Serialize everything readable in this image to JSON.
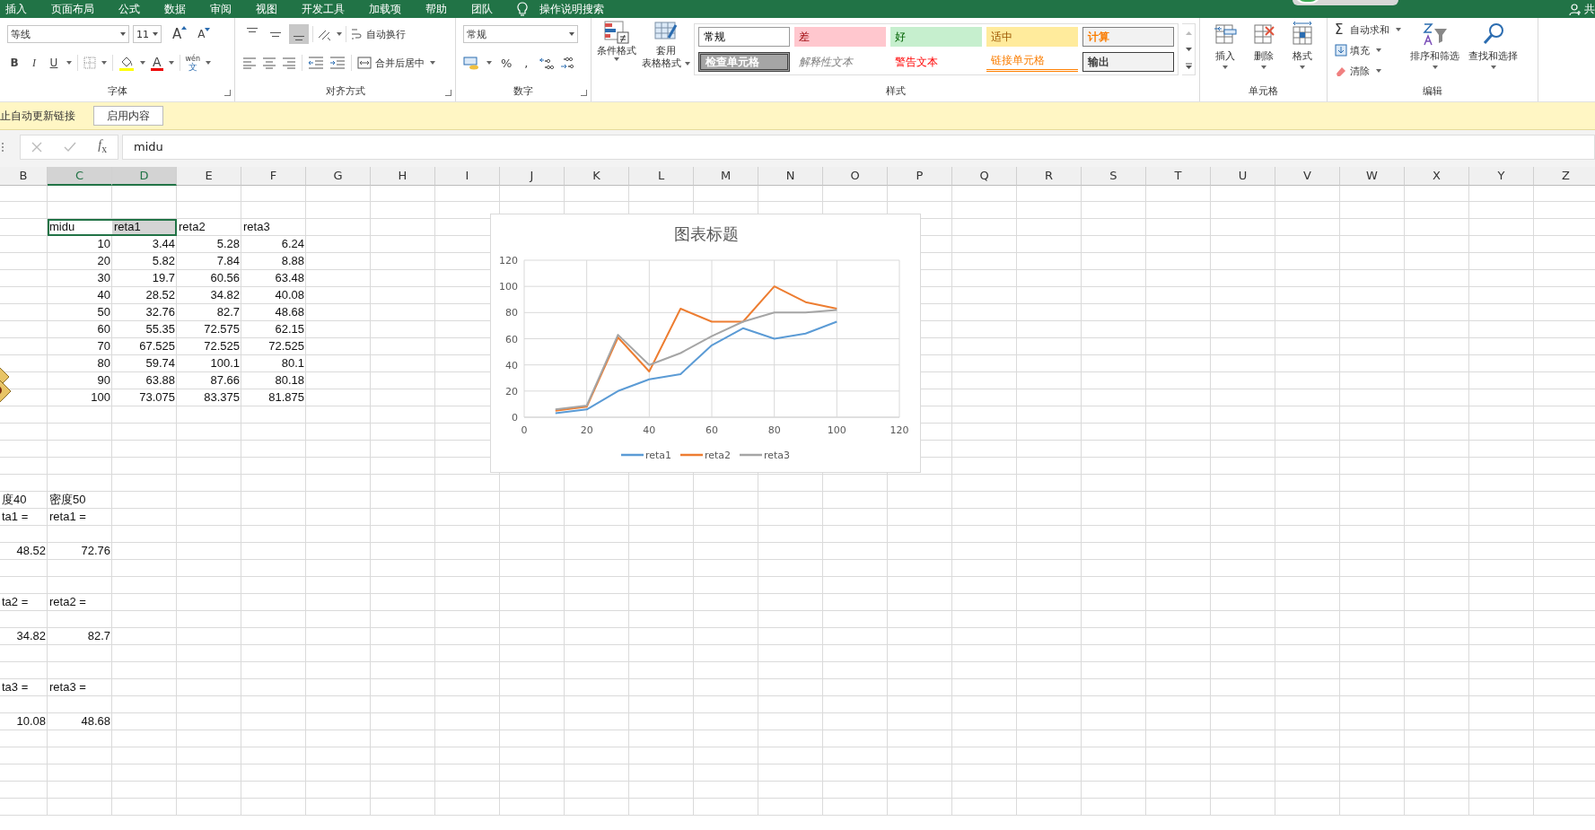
{
  "menu_tabs": [
    "插入",
    "页面布局",
    "公式",
    "数据",
    "审阅",
    "视图",
    "开发工具",
    "加载项",
    "帮助",
    "团队"
  ],
  "tell_me": "操作说明搜索",
  "share": "共",
  "ribbon": {
    "font": {
      "label": "字体",
      "font_name": "等线",
      "font_size": "11",
      "grow": "A",
      "shrink": "A",
      "bold": "B",
      "italic": "I",
      "underline": "U",
      "font_color": "A",
      "phonetic_top": "wén",
      "phonetic_bottom": "文"
    },
    "alignment": {
      "label": "对齐方式",
      "vertical": [
        {
          "selected": false
        },
        {
          "selected": false
        },
        {
          "selected": true
        }
      ],
      "wrap": "自动换行",
      "merge": "合并后居中"
    },
    "number": {
      "label": "数字",
      "format": "常规",
      "percent": "%",
      "comma": ","
    },
    "styles": {
      "label": "样式",
      "conditional": "条件格式",
      "table_top": "套用",
      "table_bottom": "表格格式",
      "cell_styles": [
        {
          "text": "常规",
          "kind": "normal"
        },
        {
          "text": "差",
          "kind": "bad"
        },
        {
          "text": "好",
          "kind": "good"
        },
        {
          "text": "适中",
          "kind": "neutral"
        },
        {
          "text": "计算",
          "kind": "calculation"
        },
        {
          "text": "检查单元格",
          "kind": "check"
        },
        {
          "text": "解释性文本",
          "kind": "explanatory"
        },
        {
          "text": "警告文本",
          "kind": "warning"
        },
        {
          "text": "链接单元格",
          "kind": "linked"
        },
        {
          "text": "输出",
          "kind": "output"
        }
      ]
    },
    "cells": {
      "label": "单元格",
      "buttons": [
        {
          "text": "插入",
          "kind": "insert"
        },
        {
          "text": "删除",
          "kind": "delete"
        },
        {
          "text": "格式",
          "kind": "format"
        }
      ]
    },
    "editing": {
      "label": "编辑",
      "autosum_symbol": "Σ",
      "autosum": "自动求和",
      "fill": "填充",
      "clear": "清除",
      "sort": "排序和筛选",
      "find": "查找和选择"
    }
  },
  "message_bar": {
    "text": "止自动更新链接",
    "button": "启用内容"
  },
  "formula_bar": {
    "function_label": "*f*$_{x}$",
    "value": "midu"
  },
  "sheet": {
    "columns": [
      {
        "label": "B",
        "selected": false
      },
      {
        "label": "C",
        "selected": true
      },
      {
        "label": "D",
        "selected": true
      },
      {
        "label": "E",
        "selected": false
      },
      {
        "label": "F",
        "selected": false
      },
      {
        "label": "G",
        "selected": false
      },
      {
        "label": "H",
        "selected": false
      },
      {
        "label": "I",
        "selected": false
      },
      {
        "label": "J",
        "selected": false
      },
      {
        "label": "K",
        "selected": false
      },
      {
        "label": "L",
        "selected": false
      },
      {
        "label": "M",
        "selected": false
      },
      {
        "label": "N",
        "selected": false
      },
      {
        "label": "O",
        "selected": false
      },
      {
        "label": "P",
        "selected": false
      },
      {
        "label": "Q",
        "selected": false
      },
      {
        "label": "R",
        "selected": false
      },
      {
        "label": "S",
        "selected": false
      },
      {
        "label": "T",
        "selected": false
      },
      {
        "label": "U",
        "selected": false
      },
      {
        "label": "V",
        "selected": false
      },
      {
        "label": "W",
        "selected": false
      },
      {
        "label": "X",
        "selected": false
      },
      {
        "label": "Y",
        "selected": false
      },
      {
        "label": "Z",
        "selected": false
      }
    ],
    "rows": [
      {},
      {},
      {
        "C": {
          "text": "midu",
          "selected": true
        },
        "D": {
          "text": "reta1",
          "selected": true
        },
        "E": {
          "text": "reta2",
          "selected": false
        },
        "F": {
          "text": "reta3",
          "selected": false
        }
      },
      {
        "C": {
          "text": "10",
          "selected": false
        },
        "D": {
          "text": "3.44",
          "selected": false
        },
        "E": {
          "text": "5.28",
          "selected": false
        },
        "F": {
          "text": "6.24",
          "selected": false
        }
      },
      {
        "C": {
          "text": "20",
          "selected": false
        },
        "D": {
          "text": "5.82",
          "selected": false
        },
        "E": {
          "text": "7.84",
          "selected": false
        },
        "F": {
          "text": "8.88",
          "selected": false
        }
      },
      {
        "C": {
          "text": "30",
          "selected": false
        },
        "D": {
          "text": "19.7",
          "selected": false
        },
        "E": {
          "text": "60.56",
          "selected": false
        },
        "F": {
          "text": "63.48",
          "selected": false
        }
      },
      {
        "C": {
          "text": "40",
          "selected": false
        },
        "D": {
          "text": "28.52",
          "selected": false
        },
        "E": {
          "text": "34.82",
          "selected": false
        },
        "F": {
          "text": "40.08",
          "selected": false
        }
      },
      {
        "C": {
          "text": "50",
          "selected": false
        },
        "D": {
          "text": "32.76",
          "selected": false
        },
        "E": {
          "text": "82.7",
          "selected": false
        },
        "F": {
          "text": "48.68",
          "selected": false
        }
      },
      {
        "C": {
          "text": "60",
          "selected": false
        },
        "D": {
          "text": "55.35",
          "selected": false
        },
        "E": {
          "text": "72.575",
          "selected": false
        },
        "F": {
          "text": "62.15",
          "selected": false
        }
      },
      {
        "C": {
          "text": "70",
          "selected": false
        },
        "D": {
          "text": "67.525",
          "selected": false
        },
        "E": {
          "text": "72.525",
          "selected": false
        },
        "F": {
          "text": "72.525",
          "selected": false
        }
      },
      {
        "C": {
          "text": "80",
          "selected": false
        },
        "D": {
          "text": "59.74",
          "selected": false
        },
        "E": {
          "text": "100.1",
          "selected": false
        },
        "F": {
          "text": "80.1",
          "selected": false
        }
      },
      {
        "C": {
          "text": "90",
          "selected": false
        },
        "D": {
          "text": "63.88",
          "selected": false
        },
        "E": {
          "text": "87.66",
          "selected": false
        },
        "F": {
          "text": "80.18",
          "selected": false
        }
      },
      {
        "C": {
          "text": "100",
          "selected": false
        },
        "D": {
          "text": "73.075",
          "selected": false
        },
        "E": {
          "text": "83.375",
          "selected": false
        },
        "F": {
          "text": "81.875",
          "selected": false
        }
      },
      {},
      {},
      {},
      {},
      {},
      {
        "B": {
          "text": "度40",
          "selected": false
        },
        "C": {
          "text": "密度50",
          "selected": false
        }
      },
      {
        "B": {
          "text": "ta1 =",
          "selected": false
        },
        "C": {
          "text": "reta1 =",
          "selected": false
        }
      },
      {},
      {
        "B": {
          "text": "48.52",
          "selected": false
        },
        "C": {
          "text": "72.76",
          "selected": false
        }
      },
      {},
      {},
      {
        "B": {
          "text": "ta2 =",
          "selected": false
        },
        "C": {
          "text": "reta2 =",
          "selected": false
        }
      },
      {},
      {
        "B": {
          "text": "34.82",
          "selected": false
        },
        "C": {
          "text": "82.7",
          "selected": false
        }
      },
      {},
      {},
      {
        "B": {
          "text": "ta3 =",
          "selected": false
        },
        "C": {
          "text": "reta3 =",
          "selected": false
        }
      },
      {},
      {
        "B": {
          "text": "10.08",
          "selected": false
        },
        "C": {
          "text": "48.68",
          "selected": false
        }
      },
      {},
      {},
      {},
      {},
      {}
    ]
  },
  "chart": {
    "chart_data": {
      "type": "line",
      "title": "图表标题",
      "x": [
        10,
        20,
        30,
        40,
        50,
        60,
        70,
        80,
        90,
        100
      ],
      "series": [
        {
          "name": "reta1",
          "color": "#5b9bd5",
          "values": [
            3,
            6,
            20,
            29,
            33,
            55,
            68,
            60,
            64,
            73
          ]
        },
        {
          "name": "reta2",
          "color": "#ed7d31",
          "values": [
            5,
            8,
            61,
            35,
            83,
            73,
            73,
            100,
            88,
            83
          ]
        },
        {
          "name": "reta3",
          "color": "#a5a5a5",
          "values": [
            6,
            9,
            63,
            40,
            49,
            62,
            73,
            80,
            80,
            82
          ]
        }
      ],
      "xlim": [
        0,
        120
      ],
      "ylim": [
        0,
        120
      ],
      "xticks": [
        {
          "value": 0,
          "label": "0"
        },
        {
          "value": 20,
          "label": "20"
        },
        {
          "value": 40,
          "label": "40"
        },
        {
          "value": 60,
          "label": "60"
        },
        {
          "value": 80,
          "label": "80"
        },
        {
          "value": 100,
          "label": "100"
        },
        {
          "value": 120,
          "label": "120"
        }
      ],
      "yticks": [
        {
          "value": 0,
          "label": "0"
        },
        {
          "value": 20,
          "label": "20"
        },
        {
          "value": 40,
          "label": "40"
        },
        {
          "value": 60,
          "label": "60"
        },
        {
          "value": 80,
          "label": "80"
        },
        {
          "value": 100,
          "label": "100"
        },
        {
          "value": 120,
          "label": "120"
        }
      ],
      "grid": true,
      "legend": "bottom"
    }
  }
}
